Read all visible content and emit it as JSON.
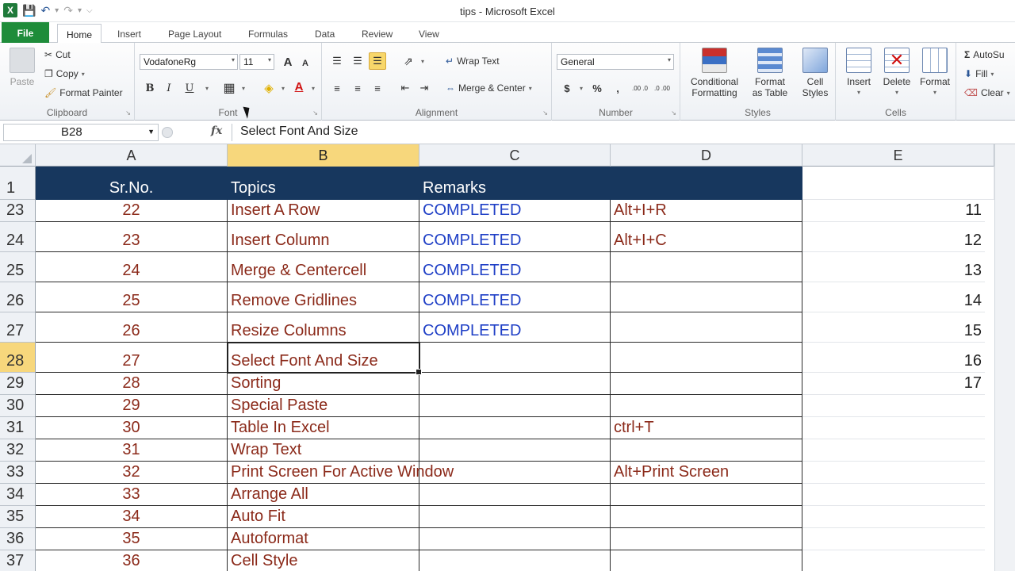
{
  "window": {
    "title": "tips  -  Microsoft Excel"
  },
  "qat": {
    "logo": "X"
  },
  "tabs": [
    {
      "label": "File",
      "kind": "file"
    },
    {
      "label": "Home",
      "kind": "active"
    },
    {
      "label": "Insert"
    },
    {
      "label": "Page Layout"
    },
    {
      "label": "Formulas"
    },
    {
      "label": "Data"
    },
    {
      "label": "Review"
    },
    {
      "label": "View"
    }
  ],
  "ribbon": {
    "clipboard": {
      "label": "Clipboard",
      "paste": "Paste",
      "cut": "Cut",
      "copy": "Copy",
      "format_painter": "Format Painter"
    },
    "font": {
      "label": "Font",
      "font_name": "VodafoneRg",
      "font_size": "11",
      "bold": "B",
      "italic": "I",
      "underline": "U",
      "grow": "A",
      "shrink": "A"
    },
    "alignment": {
      "label": "Alignment",
      "wrap_text": "Wrap Text",
      "merge_center": "Merge & Center"
    },
    "number": {
      "label": "Number",
      "format": "General",
      "currency": "$",
      "percent": "%",
      "comma": ",",
      "inc_decimal": ".00 .0",
      "dec_decimal": ".0 .00"
    },
    "styles": {
      "label": "Styles",
      "conditional": "Conditional",
      "conditional2": "Formatting",
      "format_table": "Format",
      "format_table2": "as Table",
      "cell_styles": "Cell",
      "cell_styles2": "Styles"
    },
    "cells": {
      "label": "Cells",
      "insert": "Insert",
      "delete": "Delete",
      "format": "Format"
    },
    "editing": {
      "autosum": "AutoSu",
      "fill": "Fill",
      "clear": "Clear"
    }
  },
  "formula_bar": {
    "name_box": "B28",
    "fx": "fx",
    "value": "Select Font And Size"
  },
  "columns": [
    "A",
    "B",
    "C",
    "D",
    "E"
  ],
  "header_row": {
    "num": "1",
    "a": "Sr.No.",
    "b": "Topics",
    "c": "Remarks",
    "d": ""
  },
  "rows": [
    {
      "num": "23",
      "a": "22",
      "b": "Insert A Row",
      "c": "COMPLETED",
      "d": "Alt+I+R",
      "e": "11"
    },
    {
      "num": "24",
      "a": "23",
      "b": "Insert Column",
      "c": "COMPLETED",
      "d": "Alt+I+C",
      "e": "12"
    },
    {
      "num": "25",
      "a": "24",
      "b": "Merge & Centercell",
      "c": "COMPLETED",
      "d": "",
      "e": "13"
    },
    {
      "num": "26",
      "a": "25",
      "b": "Remove Gridlines",
      "c": "COMPLETED",
      "d": "",
      "e": "14"
    },
    {
      "num": "27",
      "a": "26",
      "b": "Resize Columns",
      "c": "COMPLETED",
      "d": "",
      "e": "15"
    },
    {
      "num": "28",
      "a": "27",
      "b": "Select Font And Size",
      "c": "",
      "d": "",
      "e": "16"
    },
    {
      "num": "29",
      "a": "28",
      "b": "Sorting",
      "c": "",
      "d": "",
      "e": "17"
    },
    {
      "num": "30",
      "a": "29",
      "b": "Special Paste",
      "c": "",
      "d": "",
      "e": ""
    },
    {
      "num": "31",
      "a": "30",
      "b": "Table In Excel",
      "c": "",
      "d": "ctrl+T",
      "e": ""
    },
    {
      "num": "32",
      "a": "31",
      "b": "Wrap Text",
      "c": "",
      "d": "",
      "e": ""
    },
    {
      "num": "33",
      "a": "32",
      "b": "Print Screen For Active Window",
      "c": "",
      "d": "Alt+Print Screen",
      "e": ""
    },
    {
      "num": "34",
      "a": "33",
      "b": "Arrange All",
      "c": "",
      "d": "",
      "e": ""
    },
    {
      "num": "35",
      "a": "34",
      "b": "Auto Fit",
      "c": "",
      "d": "",
      "e": ""
    },
    {
      "num": "36",
      "a": "35",
      "b": "Autoformat",
      "c": "",
      "d": "",
      "e": ""
    },
    {
      "num": "37",
      "a": "36",
      "b": "Cell Style",
      "c": "",
      "d": "",
      "e": ""
    }
  ],
  "colors": {
    "header_fill": "#17375e",
    "remarks_text": "#1f3fc6",
    "topic_text": "#8b2a1a",
    "selection": "#f7d77c"
  }
}
